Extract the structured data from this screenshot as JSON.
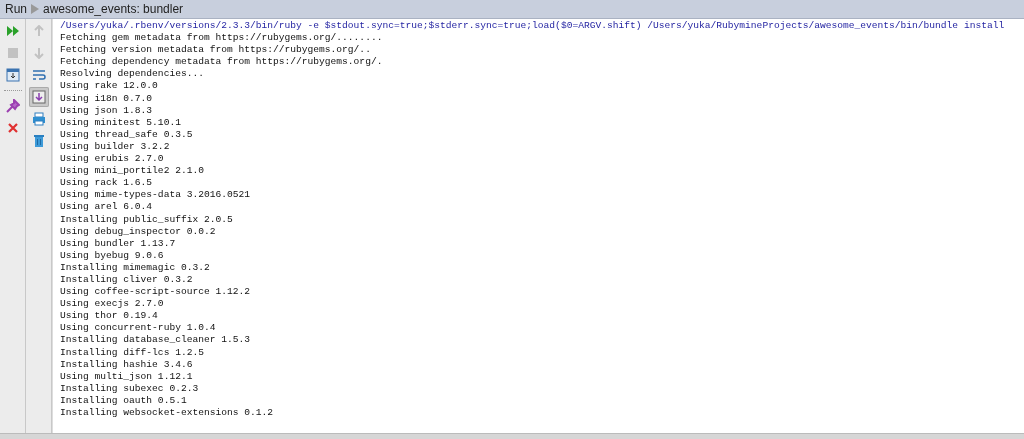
{
  "header": {
    "label": "Run",
    "title": "awesome_events: bundler"
  },
  "toolbar_left": [
    {
      "kind": "rerun",
      "disabled": false
    },
    {
      "kind": "stop",
      "disabled": true
    },
    {
      "kind": "restore",
      "disabled": false
    },
    {
      "kind": "separator"
    },
    {
      "kind": "pin",
      "disabled": false
    },
    {
      "kind": "close",
      "disabled": false
    }
  ],
  "toolbar_right": [
    {
      "kind": "up",
      "disabled": true
    },
    {
      "kind": "down",
      "disabled": true
    },
    {
      "kind": "wrap",
      "disabled": false,
      "selected": false
    },
    {
      "kind": "scroll",
      "disabled": false,
      "selected": true
    },
    {
      "kind": "print",
      "disabled": false
    },
    {
      "kind": "trash",
      "disabled": false
    }
  ],
  "console": [
    {
      "kind": "command",
      "text": "/Users/yuka/.rbenv/versions/2.3.3/bin/ruby -e $stdout.sync=true;$stderr.sync=true;load($0=ARGV.shift) /Users/yuka/RubymineProjects/awesome_events/bin/bundle install"
    },
    {
      "kind": "output",
      "text": "Fetching gem metadata from https://rubygems.org/........"
    },
    {
      "kind": "output",
      "text": "Fetching version metadata from https://rubygems.org/.."
    },
    {
      "kind": "output",
      "text": "Fetching dependency metadata from https://rubygems.org/."
    },
    {
      "kind": "output",
      "text": "Resolving dependencies..."
    },
    {
      "kind": "output",
      "text": "Using rake 12.0.0"
    },
    {
      "kind": "output",
      "text": "Using i18n 0.7.0"
    },
    {
      "kind": "output",
      "text": "Using json 1.8.3"
    },
    {
      "kind": "output",
      "text": "Using minitest 5.10.1"
    },
    {
      "kind": "output",
      "text": "Using thread_safe 0.3.5"
    },
    {
      "kind": "output",
      "text": "Using builder 3.2.2"
    },
    {
      "kind": "output",
      "text": "Using erubis 2.7.0"
    },
    {
      "kind": "output",
      "text": "Using mini_portile2 2.1.0"
    },
    {
      "kind": "output",
      "text": "Using rack 1.6.5"
    },
    {
      "kind": "output",
      "text": "Using mime-types-data 3.2016.0521"
    },
    {
      "kind": "output",
      "text": "Using arel 6.0.4"
    },
    {
      "kind": "output",
      "text": "Installing public_suffix 2.0.5"
    },
    {
      "kind": "output",
      "text": "Using debug_inspector 0.0.2"
    },
    {
      "kind": "output",
      "text": "Using bundler 1.13.7"
    },
    {
      "kind": "output",
      "text": "Using byebug 9.0.6"
    },
    {
      "kind": "output",
      "text": "Installing mimemagic 0.3.2"
    },
    {
      "kind": "output",
      "text": "Installing cliver 0.3.2"
    },
    {
      "kind": "output",
      "text": "Using coffee-script-source 1.12.2"
    },
    {
      "kind": "output",
      "text": "Using execjs 2.7.0"
    },
    {
      "kind": "output",
      "text": "Using thor 0.19.4"
    },
    {
      "kind": "output",
      "text": "Using concurrent-ruby 1.0.4"
    },
    {
      "kind": "output",
      "text": "Installing database_cleaner 1.5.3"
    },
    {
      "kind": "output",
      "text": "Installing diff-lcs 1.2.5"
    },
    {
      "kind": "output",
      "text": "Installing hashie 3.4.6"
    },
    {
      "kind": "output",
      "text": "Using multi_json 1.12.1"
    },
    {
      "kind": "output",
      "text": "Installing subexec 0.2.3"
    },
    {
      "kind": "output",
      "text": "Installing oauth 0.5.1"
    },
    {
      "kind": "output",
      "text": "Installing websocket-extensions 0.1.2"
    }
  ]
}
